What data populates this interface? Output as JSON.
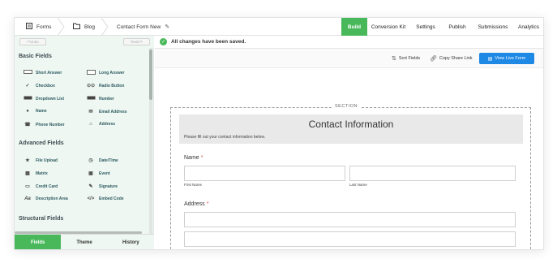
{
  "breadcrumbs": [
    {
      "label": "Forms",
      "icon": "forms-icon"
    },
    {
      "label": "Blog",
      "icon": "folder-icon"
    },
    {
      "label": "Contact Form New",
      "icon": "edit-icon"
    }
  ],
  "nav": [
    {
      "label": "Build",
      "active": true
    },
    {
      "label": "Conversion Kit",
      "active": false
    },
    {
      "label": "Settings",
      "active": false
    },
    {
      "label": "Publish",
      "active": false
    },
    {
      "label": "Submissions",
      "active": false
    },
    {
      "label": "Analytics",
      "active": false
    }
  ],
  "sidebar": {
    "undo_label": "Undo",
    "redo_label": "Redo",
    "sections": [
      {
        "title": "Basic Fields",
        "fields": [
          {
            "label": "Short Answer",
            "icon": "short-answer-icon"
          },
          {
            "label": "Long Answer",
            "icon": "long-answer-icon"
          },
          {
            "label": "Checkbox",
            "icon": "checkbox-icon"
          },
          {
            "label": "Radio Button",
            "icon": "radio-button-icon"
          },
          {
            "label": "Dropdown List",
            "icon": "dropdown-icon"
          },
          {
            "label": "Number",
            "icon": "number-icon"
          },
          {
            "label": "Name",
            "icon": "person-icon"
          },
          {
            "label": "Email Address",
            "icon": "email-icon"
          },
          {
            "label": "Phone Number",
            "icon": "phone-icon"
          },
          {
            "label": "Address",
            "icon": "house-icon"
          }
        ]
      },
      {
        "title": "Advanced Fields",
        "fields": [
          {
            "label": "File Upload",
            "icon": "upload-icon"
          },
          {
            "label": "Date/Time",
            "icon": "clock-icon"
          },
          {
            "label": "Matrix",
            "icon": "matrix-icon"
          },
          {
            "label": "Event",
            "icon": "calendar-icon"
          },
          {
            "label": "Credit Card",
            "icon": "credit-card-icon"
          },
          {
            "label": "Signature",
            "icon": "pen-icon"
          },
          {
            "label": "Description Area",
            "icon": "text-icon"
          },
          {
            "label": "Embed Code",
            "icon": "code-icon"
          }
        ]
      },
      {
        "title": "Structural Fields",
        "fields": []
      }
    ],
    "tabs": [
      {
        "label": "Fields",
        "active": true
      },
      {
        "label": "Theme",
        "active": false
      },
      {
        "label": "History",
        "active": false
      }
    ]
  },
  "status": {
    "text": "All changes have been saved."
  },
  "toolbar": {
    "sort_label": "Sort Fields",
    "share_label": "Copy Share Link",
    "live_label": "View Live Form"
  },
  "form": {
    "section_label": "SECTION",
    "title": "Contact Information",
    "description": "Please fill out your contact information below.",
    "name_label": "Name",
    "required_mark": "*",
    "first_name_label": "First Name",
    "last_name_label": "Last Name",
    "address_label": "Address"
  },
  "colors": {
    "accent": "#48b85a",
    "primary_button": "#1e88e5",
    "sidebar_bg": "#eef7f1"
  }
}
